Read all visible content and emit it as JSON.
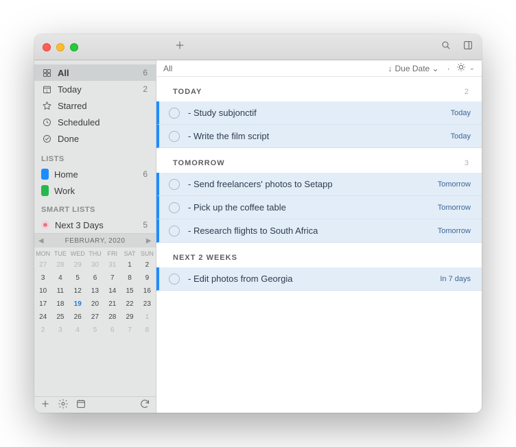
{
  "sidebar": {
    "nav": [
      {
        "icon": "grid",
        "label": "All",
        "count": "6",
        "selected": true
      },
      {
        "icon": "cal-today",
        "label": "Today",
        "count": "2"
      },
      {
        "icon": "star",
        "label": "Starred",
        "count": ""
      },
      {
        "icon": "clock",
        "label": "Scheduled",
        "count": ""
      },
      {
        "icon": "check",
        "label": "Done",
        "count": ""
      }
    ],
    "lists_header": "LISTS",
    "lists": [
      {
        "color": "#1c8cff",
        "label": "Home",
        "count": "6"
      },
      {
        "color": "#25b84c",
        "label": "Work",
        "count": ""
      }
    ],
    "smart_header": "SMART LISTS",
    "smart": [
      {
        "label": "Next 3 Days",
        "count": "5"
      }
    ]
  },
  "calendar": {
    "title": "FEBRUARY, 2020",
    "dow": [
      "MON",
      "TUE",
      "WED",
      "THU",
      "FRI",
      "SAT",
      "SUN"
    ],
    "cells": [
      {
        "n": "27",
        "dim": true
      },
      {
        "n": "28",
        "dim": true
      },
      {
        "n": "29",
        "dim": true
      },
      {
        "n": "30",
        "dim": true
      },
      {
        "n": "31",
        "dim": true
      },
      {
        "n": "1"
      },
      {
        "n": "2"
      },
      {
        "n": "3"
      },
      {
        "n": "4"
      },
      {
        "n": "5"
      },
      {
        "n": "6"
      },
      {
        "n": "7"
      },
      {
        "n": "8"
      },
      {
        "n": "9"
      },
      {
        "n": "10"
      },
      {
        "n": "11"
      },
      {
        "n": "12"
      },
      {
        "n": "13"
      },
      {
        "n": "14"
      },
      {
        "n": "15"
      },
      {
        "n": "16"
      },
      {
        "n": "17"
      },
      {
        "n": "18"
      },
      {
        "n": "19",
        "today": true
      },
      {
        "n": "20"
      },
      {
        "n": "21"
      },
      {
        "n": "22"
      },
      {
        "n": "23"
      },
      {
        "n": "24"
      },
      {
        "n": "25"
      },
      {
        "n": "26"
      },
      {
        "n": "27"
      },
      {
        "n": "28"
      },
      {
        "n": "29"
      },
      {
        "n": "1",
        "dim": true
      },
      {
        "n": "2",
        "dim": true
      },
      {
        "n": "3",
        "dim": true
      },
      {
        "n": "4",
        "dim": true
      },
      {
        "n": "5",
        "dim": true
      },
      {
        "n": "6",
        "dim": true
      },
      {
        "n": "7",
        "dim": true
      },
      {
        "n": "8",
        "dim": true
      }
    ]
  },
  "filter": {
    "scope": "All",
    "sort": "Due Date"
  },
  "groups": [
    {
      "title": "TODAY",
      "count": "2",
      "tasks": [
        {
          "title": "- Study subjonctif",
          "due": "Today"
        },
        {
          "title": "- Write the film script",
          "due": "Today"
        }
      ]
    },
    {
      "title": "TOMORROW",
      "count": "3",
      "tasks": [
        {
          "title": "- Send freelancers' photos to Setapp",
          "due": "Tomorrow"
        },
        {
          "title": "- Pick up the coffee table",
          "due": "Tomorrow"
        },
        {
          "title": "- Research flights to South Africa",
          "due": "Tomorrow"
        }
      ]
    },
    {
      "title": "NEXT 2 WEEKS",
      "count": "",
      "tasks": [
        {
          "title": "- Edit photos from Georgia",
          "due": "In 7 days"
        }
      ]
    }
  ]
}
